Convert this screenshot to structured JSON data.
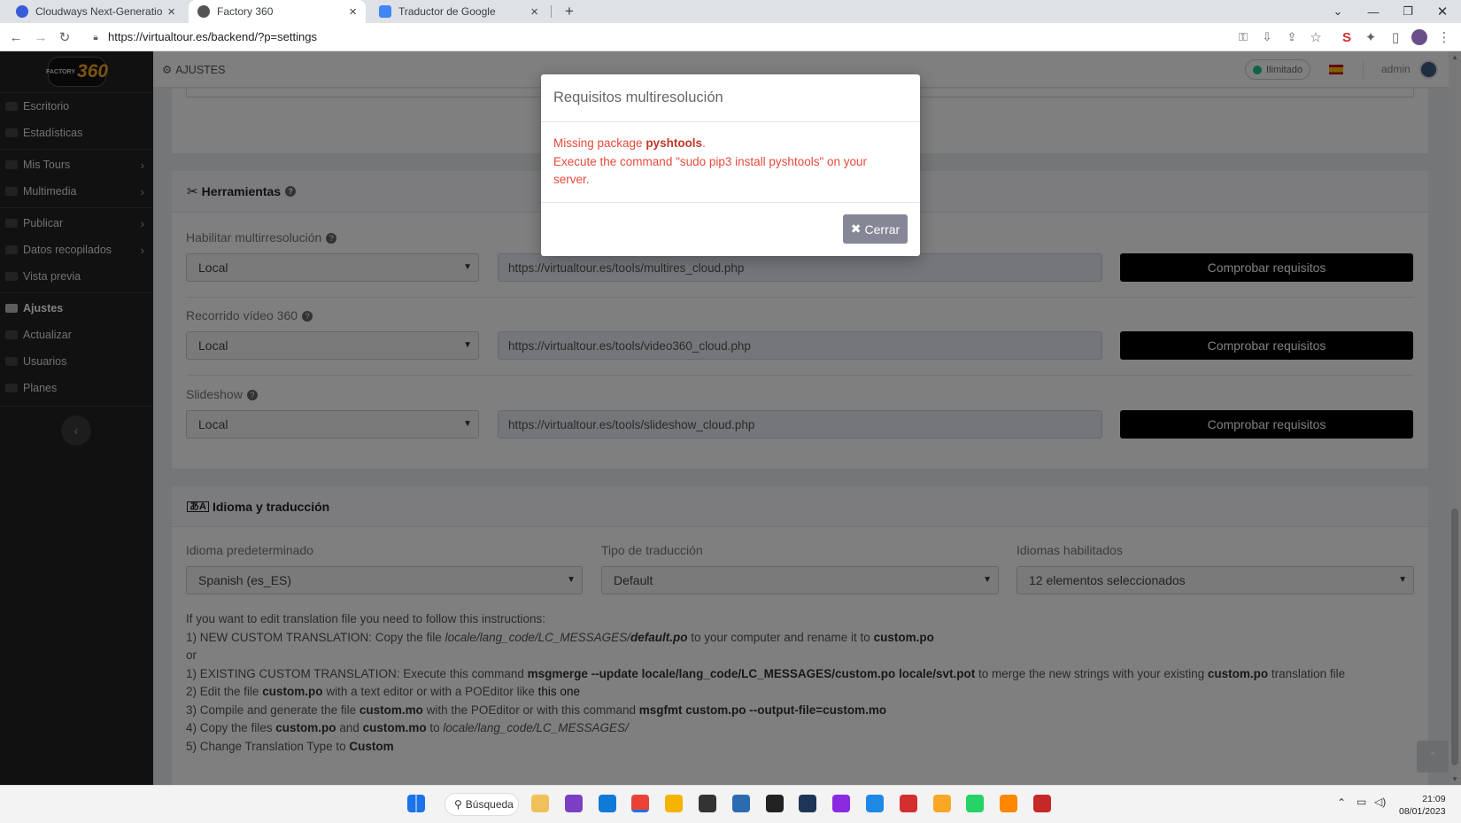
{
  "browser": {
    "tabs": [
      {
        "title": "Cloudways Next-Generation Clou",
        "active": false,
        "favicon_color": "#3a5bd9"
      },
      {
        "title": "Factory 360",
        "active": true,
        "favicon_color": "#555555"
      },
      {
        "title": "Traductor de Google",
        "active": false,
        "favicon_color": "#4285f4"
      }
    ],
    "new_tab": "+",
    "url": "https://virtualtour.es/backend/?p=settings"
  },
  "sidebar": {
    "logo_small": "FACTORY",
    "logo_big": "360",
    "items": [
      {
        "label": "Escritorio",
        "has_submenu": false,
        "active": false
      },
      {
        "label": "Estadísticas",
        "has_submenu": false,
        "active": false
      },
      {
        "label": "Mis Tours",
        "has_submenu": true,
        "active": false
      },
      {
        "label": "Multimedia",
        "has_submenu": true,
        "active": false
      },
      {
        "label": "Publicar",
        "has_submenu": true,
        "active": false
      },
      {
        "label": "Datos recopilados",
        "has_submenu": true,
        "active": false
      },
      {
        "label": "Vista previa",
        "has_submenu": false,
        "active": false
      },
      {
        "label": "Ajustes",
        "has_submenu": false,
        "active": true
      },
      {
        "label": "Actualizar",
        "has_submenu": false,
        "active": false
      },
      {
        "label": "Usuarios",
        "has_submenu": false,
        "active": false
      },
      {
        "label": "Planes",
        "has_submenu": false,
        "active": false
      }
    ]
  },
  "topbar": {
    "breadcrumb": "AJUSTES",
    "plan_badge": "Ilimitado",
    "user": "admin"
  },
  "tools": {
    "title": "Herramientas",
    "rows": [
      {
        "label": "Habilitar multirresolución",
        "select": "Local",
        "url": "https://virtualtour.es/tools/multires_cloud.php",
        "button": "Comprobar requisitos"
      },
      {
        "label": "Recorrido vídeo 360",
        "select": "Local",
        "url": "https://virtualtour.es/tools/video360_cloud.php",
        "button": "Comprobar requisitos"
      },
      {
        "label": "Slideshow",
        "select": "Local",
        "url": "https://virtualtour.es/tools/slideshow_cloud.php",
        "button": "Comprobar requisitos"
      }
    ]
  },
  "language": {
    "title": "Idioma y traducción",
    "fields": [
      {
        "label": "Idioma predeterminado",
        "value": "Spanish (es_ES)"
      },
      {
        "label": "Tipo de traducción",
        "value": "Default"
      },
      {
        "label": "Idiomas habilitados",
        "value": "12 elementos seleccionados"
      }
    ],
    "instructions": [
      [
        {
          "t": "If you want to edit translation file you need to follow this instructions:"
        }
      ],
      [
        {
          "t": "1) NEW CUSTOM TRANSLATION: Copy the file "
        },
        {
          "t": "locale/lang_code/LC_MESSAGES/",
          "s": "i"
        },
        {
          "t": "default.po",
          "s": "bi"
        },
        {
          "t": " to your computer and rename it to "
        },
        {
          "t": "custom.po",
          "s": "b"
        }
      ],
      [
        {
          "t": "or"
        }
      ],
      [
        {
          "t": "1) EXISTING CUSTOM TRANSLATION: Execute this command "
        },
        {
          "t": "msgmerge --update locale/lang_code/LC_MESSAGES/custom.po locale/svt.pot",
          "s": "b"
        },
        {
          "t": " to merge the new strings with your existing "
        },
        {
          "t": "custom.po",
          "s": "b"
        },
        {
          "t": " translation file"
        }
      ],
      [
        {
          "t": "2) Edit the file "
        },
        {
          "t": "custom.po",
          "s": "b"
        },
        {
          "t": " with a text editor or with a POEditor like "
        },
        {
          "t": "this one",
          "s": "link"
        }
      ],
      [
        {
          "t": "3) Compile and generate the file "
        },
        {
          "t": "custom.mo",
          "s": "b"
        },
        {
          "t": " with the POEditor or with this command "
        },
        {
          "t": "msgfmt custom.po --output-file=custom.mo",
          "s": "b"
        }
      ],
      [
        {
          "t": "4) Copy the files "
        },
        {
          "t": "custom.po",
          "s": "b"
        },
        {
          "t": " and "
        },
        {
          "t": "custom.mo",
          "s": "b"
        },
        {
          "t": " to "
        },
        {
          "t": "locale/lang_code/LC_MESSAGES/",
          "s": "i"
        }
      ],
      [
        {
          "t": "5) Change Translation Type to "
        },
        {
          "t": "Custom",
          "s": "b"
        }
      ]
    ]
  },
  "modal": {
    "title": "Requisitos multiresolución",
    "line1_prefix": "Missing package ",
    "package": "pyshtools",
    "line1_suffix": ".",
    "line2": "Execute the command \"sudo pip3 install pyshtools\" on your server.",
    "close_label": "Cerrar"
  },
  "taskbar": {
    "search": "Búsqueda",
    "time": "21:09",
    "date": "08/01/2023",
    "apps": [
      "#f0c05a",
      "#7b3fc4",
      "#0f7ad8",
      "#ea4335",
      "#f4b400",
      "#333333",
      "#2b6cb0",
      "#222222",
      "#1d3557",
      "#8a2be2",
      "#1e88e5",
      "#d32f2f",
      "#f9a825",
      "#25d366",
      "#ff8800",
      "#c62828"
    ]
  }
}
